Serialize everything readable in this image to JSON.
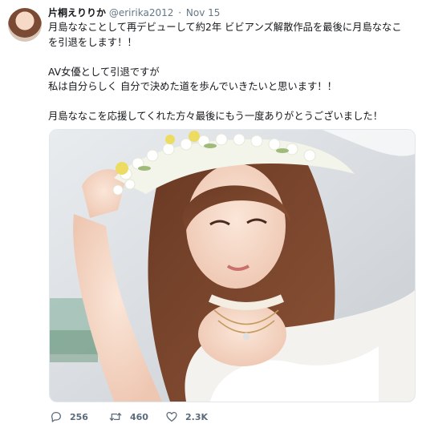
{
  "tweet": {
    "author_name": "片桐えりりか",
    "handle": "@eririka2012",
    "separator": "·",
    "time": "Nov 15",
    "text_lines": [
      "月島ななことして再デビューして約2年 ビビアンズ解散作品を最後に月島ななこ",
      "を引退をします！！",
      "",
      "AV女優として引退ですが",
      "私は自分らしく 自分で決めた道を歩んでいきたいと思います！！",
      "",
      "月島ななこを応援してくれた方々最後にもう一度ありがとうございました！"
    ],
    "stats": {
      "replies": "256",
      "retweets": "460",
      "likes": "2.3K"
    }
  },
  "icons": {
    "reply": "speech-bubble-icon",
    "retweet": "retweet-arrows-icon",
    "like": "heart-outline-icon"
  },
  "colors": {
    "text": "#14171a",
    "secondary": "#657786",
    "action": "#5b6b7a",
    "border": "#e1e8ed"
  }
}
